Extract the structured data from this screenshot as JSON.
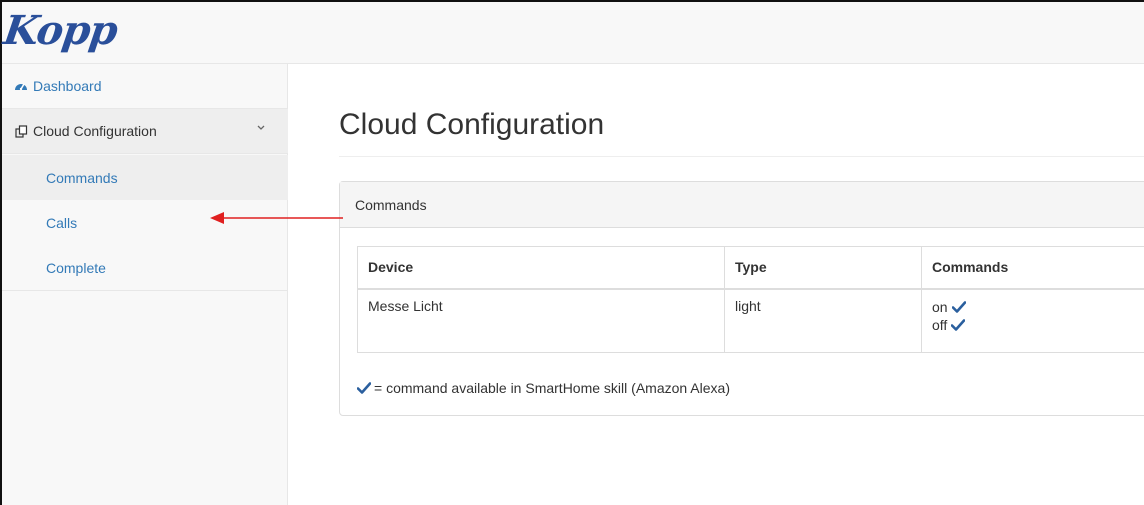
{
  "brand": {
    "logo_text": "Kopp",
    "brand_color": "#2a4f9a"
  },
  "sidebar": {
    "items": [
      {
        "label": "Dashboard",
        "icon": "tachometer-icon"
      },
      {
        "label": "Cloud Configuration",
        "icon": "copy-icon",
        "expanded": true
      }
    ],
    "subitems": [
      {
        "label": "Commands",
        "active": true
      },
      {
        "label": "Calls"
      },
      {
        "label": "Complete"
      }
    ]
  },
  "main": {
    "title": "Cloud Configuration",
    "panel": {
      "heading": "Commands",
      "columns": [
        "Device",
        "Type",
        "Commands"
      ],
      "rows": [
        {
          "device": "Messe Licht",
          "type": "light",
          "commands": [
            "on",
            "off"
          ]
        }
      ],
      "legend": "= command available in SmartHome skill (Amazon Alexa)"
    }
  },
  "colors": {
    "link": "#337ab7",
    "annotation_arrow": "#e02020",
    "check": "#2a5f9e"
  }
}
